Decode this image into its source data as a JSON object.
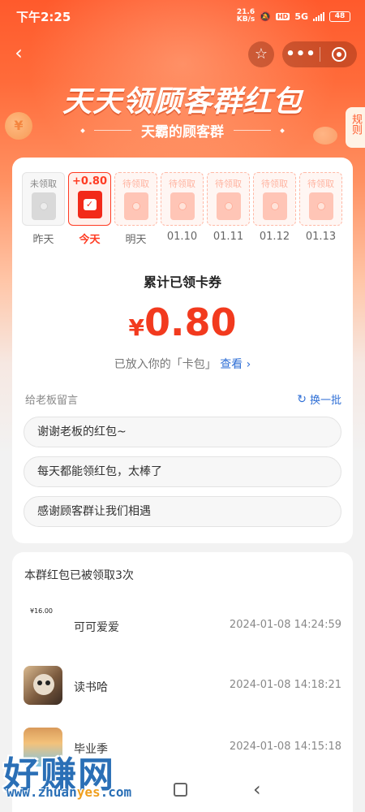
{
  "status_bar": {
    "time": "下午2:25",
    "net_speed_value": "21.6",
    "net_speed_unit": "KB/s",
    "hd": "HD",
    "network": "5G",
    "battery": "48"
  },
  "nav": {
    "back_icon": "chevron-left-icon",
    "star_icon": "star-icon",
    "more_icon": "more-dots-icon",
    "close_icon": "close-circle-icon"
  },
  "header": {
    "title": "天天领顾客群红包",
    "subtitle": "天霸的顾客群",
    "rules": "规则"
  },
  "days": [
    {
      "tag": "未领取",
      "label": "昨天",
      "state": "past"
    },
    {
      "tag": "+0.80",
      "label": "今天",
      "state": "today"
    },
    {
      "tag": "待领取",
      "label": "明天",
      "state": "future"
    },
    {
      "tag": "待领取",
      "label": "01.10",
      "state": "future"
    },
    {
      "tag": "待领取",
      "label": "01.11",
      "state": "future"
    },
    {
      "tag": "待领取",
      "label": "01.12",
      "state": "future"
    },
    {
      "tag": "待领取",
      "label": "01.13",
      "state": "future"
    }
  ],
  "summary": {
    "label": "累计已领卡券",
    "currency": "¥",
    "amount": "0.80",
    "wallet_text_prefix": "已放入你的「卡包」",
    "wallet_link": "查看",
    "wallet_chevron": "›"
  },
  "messages": {
    "title": "给老板留言",
    "refresh_label": "换一批",
    "refresh_icon": "↻",
    "items": [
      "谢谢老板的红包~",
      "每天都能领红包，太棒了",
      "感谢顾客群让我们相遇"
    ]
  },
  "records": {
    "title": "本群红包已被领取3次",
    "items": [
      {
        "name": "可可爱爱",
        "time": "2024-01-08 14:24:59",
        "avatar_text": "¥16.00"
      },
      {
        "name": "读书哈",
        "time": "2024-01-08 14:18:21"
      },
      {
        "name": "毕业季",
        "time": "2024-01-08 14:15:18"
      }
    ]
  },
  "watermark": {
    "title": "好赚网",
    "url_a": "www.zhuan",
    "url_b": "yes",
    "url_c": ".com"
  },
  "colors": {
    "accent_red": "#f23a1e",
    "link_blue": "#2f6fd6",
    "header_orange": "#ff5a2c"
  }
}
